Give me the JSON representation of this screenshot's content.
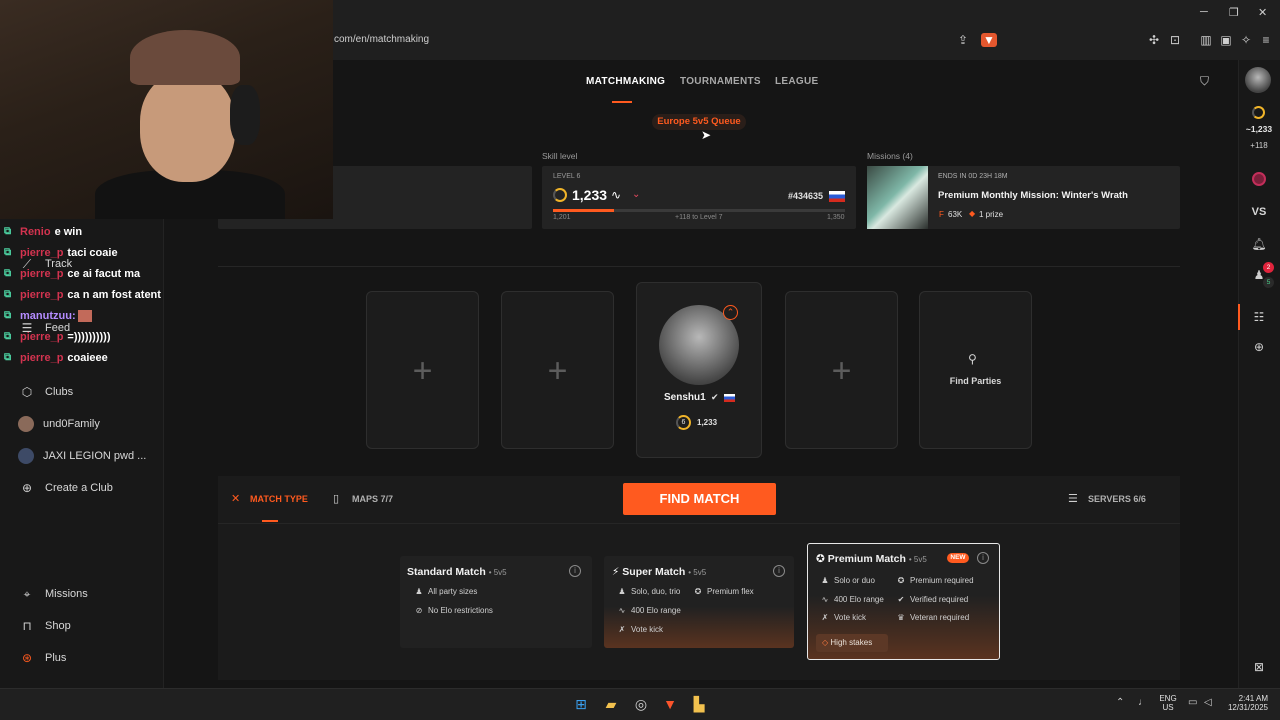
{
  "browser": {
    "url": "com/en/matchmaking",
    "colors": {
      "bar": "#1f1f1f",
      "accent": "#ff5a1f"
    }
  },
  "chat": [
    {
      "user": "Renio",
      "msg": "e win"
    },
    {
      "user": "pierre_p",
      "msg": "taci coaie"
    },
    {
      "user": "pierre_p",
      "msg": "ce ai facut ma"
    },
    {
      "user": "pierre_p",
      "msg": "ca n am fost atent"
    },
    {
      "user": "manutzuu:",
      "msg": ""
    },
    {
      "user": "pierre_p",
      "msg": "=))))))))))"
    },
    {
      "user": "pierre_p",
      "msg": "coaieee"
    }
  ],
  "sidebar": {
    "track": "Track",
    "feed": "Feed",
    "clubs": "Clubs",
    "club1": "und0Family",
    "club2": "JAXI LEGION pwd ...",
    "create_club": "Create a Club",
    "missions": "Missions",
    "shop": "Shop",
    "plus": "Plus"
  },
  "tabs": {
    "matchmaking": "MATCHMAKING",
    "tournaments": "TOURNAMENTS",
    "league": "LEAGUE"
  },
  "queue": "Europe 5v5 Queue",
  "skill": {
    "section_label": "Skill level",
    "level_label": "LEVEL 6",
    "elo": "1,233",
    "rank": "#434635",
    "min": "1,201",
    "max": "1,350",
    "to_next": "+118 to Level 7",
    "progress_fraction": 0.21
  },
  "missions": {
    "section_label": "Missions (4)",
    "ends": "ENDS IN 0D 23H 18M",
    "title": "Premium Monthly Mission: Winter's Wrath",
    "points": "63K",
    "prize": "1 prize"
  },
  "party": {
    "player_name": "Senshu1",
    "player_level": "6",
    "player_elo": "1,233",
    "find_parties": "Find Parties",
    "empty_symbol": "+"
  },
  "match_controls": {
    "match_type": "MATCH TYPE",
    "maps": "MAPS 7/7",
    "find_match": "FIND MATCH",
    "servers": "SERVERS 6/6"
  },
  "match_types": {
    "standard": {
      "title": "Standard Match",
      "mode": "• 5v5",
      "row1": "All party sizes",
      "row2": "No Elo restrictions"
    },
    "super": {
      "title": "Super Match",
      "mode": "• 5v5",
      "row1": "Solo, duo, trio",
      "row1b": "Premium flex",
      "row2": "400 Elo range",
      "row3": "Vote kick"
    },
    "premium": {
      "title": "Premium Match",
      "mode": "• 5v5",
      "badge": "NEW",
      "row1": "Solo or duo",
      "row1b": "Premium required",
      "row2": "400 Elo range",
      "row2b": "Verified required",
      "row3": "Vote kick",
      "row3b": "Veteran required",
      "stakes": "High stakes"
    }
  },
  "right_rail": {
    "elo": "~1,233",
    "gain": "+118",
    "vs": "VS",
    "notif_count": "2",
    "friends_online": "5"
  },
  "taskbar": {
    "lang1": "ENG",
    "lang2": "US",
    "time": "2:41 AM",
    "date": "12/31/2025"
  }
}
